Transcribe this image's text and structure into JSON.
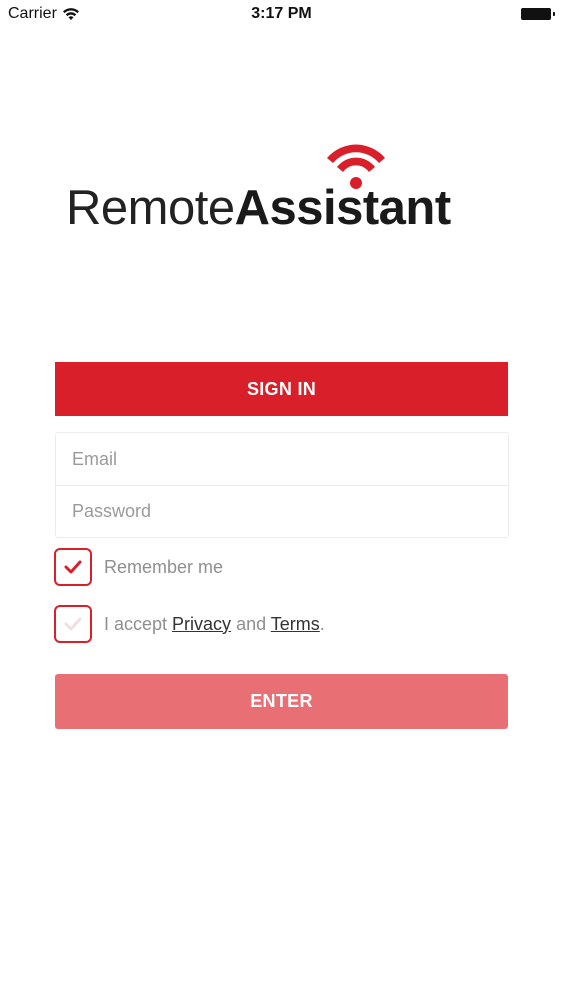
{
  "status_bar": {
    "carrier": "Carrier",
    "time": "3:17 PM"
  },
  "logo": {
    "text_light": "Remote",
    "text_bold": "Assistant",
    "signal_color": "#d9202a"
  },
  "form": {
    "header": "SIGN IN",
    "email_placeholder": "Email",
    "password_placeholder": "Password",
    "remember_label": "Remember me",
    "remember_checked": true,
    "accept_prefix": "I accept ",
    "accept_privacy": "Privacy",
    "accept_and": " and ",
    "accept_terms": "Terms",
    "accept_suffix": ".",
    "accept_checked": false,
    "enter_label": "ENTER"
  },
  "colors": {
    "brand_red": "#d9202a",
    "enter_disabled": "#e86f74"
  }
}
